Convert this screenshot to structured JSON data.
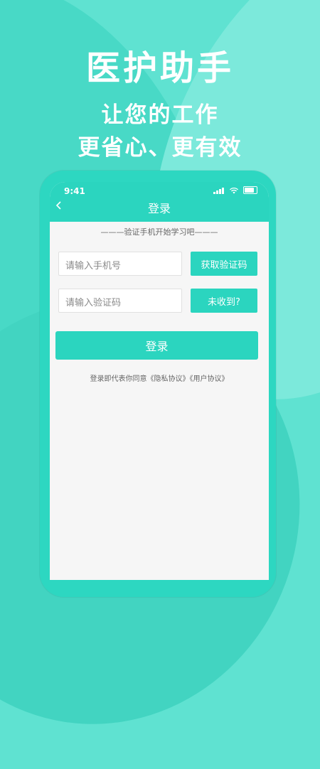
{
  "promo": {
    "title": "医护助手",
    "sub1": "让您的工作",
    "sub2": "更省心、更有效"
  },
  "phone": {
    "status_time": "9:41",
    "nav_title": "登录",
    "tip": "———验证手机开始学习吧———",
    "phone_input_placeholder": "请输入手机号",
    "get_code_label": "获取验证码",
    "code_input_placeholder": "请输入验证码",
    "not_received_label": "未收到?",
    "login_label": "登录",
    "agreement": "登录即代表你同意《隐私协议》《用户协议》"
  },
  "icons": {
    "back": "chevron-left-icon",
    "signal": "signal-icon",
    "wifi": "wifi-icon",
    "battery": "battery-icon"
  },
  "colors": {
    "accent": "#2bd5bf",
    "background": "#5fe2d1"
  }
}
